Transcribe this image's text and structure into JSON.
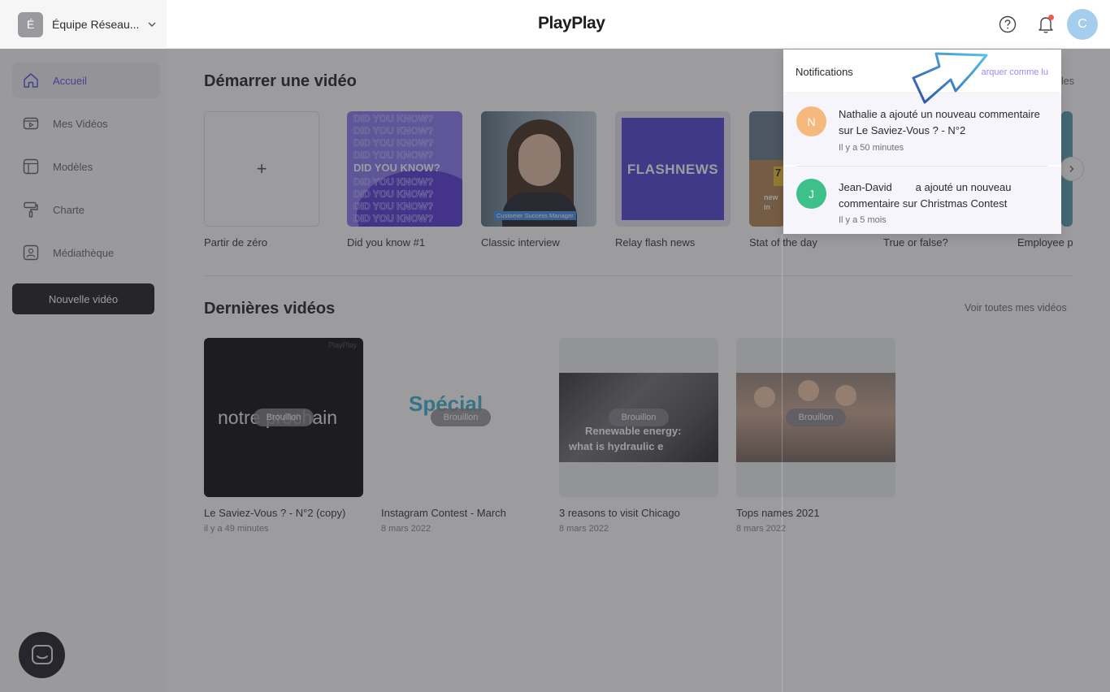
{
  "topbar": {
    "team_initial": "É",
    "team_name": "Équipe Réseau...",
    "logo": "PlayPlay",
    "user_initial": "C"
  },
  "sidebar": {
    "items": [
      {
        "label": "Accueil",
        "icon": "home-icon"
      },
      {
        "label": "Mes Vidéos",
        "icon": "video-icon"
      },
      {
        "label": "Modèles",
        "icon": "template-icon"
      },
      {
        "label": "Charte",
        "icon": "paint-roller-icon"
      },
      {
        "label": "Médiathèque",
        "icon": "image-icon"
      }
    ],
    "new_video_label": "Nouvelle vidéo"
  },
  "start": {
    "title": "Démarrer une vidéo",
    "see_all_partial": "les",
    "templates": [
      {
        "label": "Partir de zéro"
      },
      {
        "label": "Did you know #1",
        "thumb_text": "DID YOU KNOW?"
      },
      {
        "label": "Classic interview",
        "thumb_text": "Customer Success Manager"
      },
      {
        "label": "Relay flash news",
        "thumb_line1": "FLASH",
        "thumb_line2": "NEWS"
      },
      {
        "label": "Stat of the day",
        "thumb_number": "7",
        "thumb_line1": "new",
        "thumb_line2": "in"
      },
      {
        "label": "True or false?"
      },
      {
        "label": "Employee p"
      }
    ]
  },
  "latest": {
    "title": "Dernières vidéos",
    "see_all": "Voir toutes mes vidéos",
    "draft_label": "Brouillon",
    "videos": [
      {
        "title": "Le Saviez-Vous ? - N°2 (copy)",
        "date": "il y a 49 minutes",
        "thumb_text": "notre prochain",
        "thumb_mark": "PlayPlay"
      },
      {
        "title": "Instagram Contest - March",
        "date": "8 mars 2022",
        "thumb_text": "Spécial"
      },
      {
        "title": "3 reasons to visit Chicago",
        "date": "8 mars 2022",
        "thumb_line1": "Renewable energy:",
        "thumb_line2": "what is hydraulic e"
      },
      {
        "title": "Tops names 2021",
        "date": "8 mars 2022"
      }
    ]
  },
  "notifications": {
    "title": "Notifications",
    "mark_read": "arquer comme lu",
    "items": [
      {
        "initial": "N",
        "color": "#f5b97d",
        "text": "Nathalie a ajouté un nouveau commentaire sur Le Saviez-Vous ? - N°2",
        "time": "Il y a 50 minutes"
      },
      {
        "initial": "J",
        "color": "#3ec08a",
        "text": "Jean-David        a ajouté un nouveau commentaire sur Christmas Contest",
        "time": "Il y a 5 mois"
      }
    ]
  },
  "colors": {
    "accent": "#5f57e8",
    "bell_dot": "#ee5a52",
    "arrow": "#2f5fb8"
  }
}
